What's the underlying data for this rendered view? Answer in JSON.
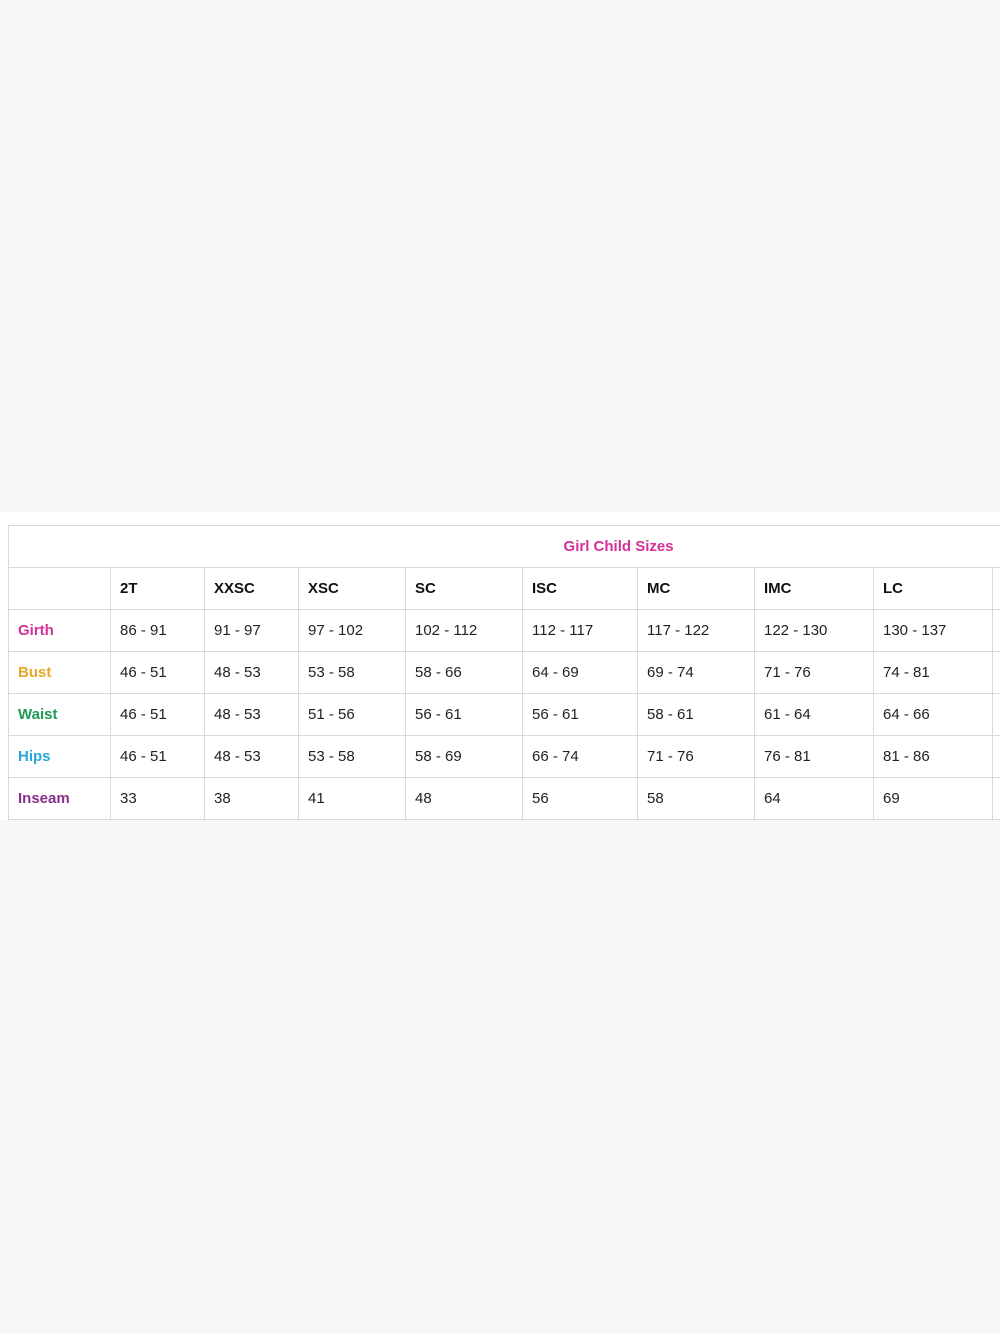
{
  "table": {
    "title": "Girl Child Sizes",
    "sizes": [
      "2T",
      "XXSC",
      "XSC",
      "SC",
      "ISC",
      "MC",
      "IMC",
      "LC"
    ],
    "rows": [
      {
        "label": "Girth",
        "color": "#d62f9a",
        "values": [
          "86 - 91",
          "91 - 97",
          "97 - 102",
          "102 - 112",
          "112 - 117",
          "117 - 122",
          "122 - 130",
          "130 - 137"
        ]
      },
      {
        "label": "Bust",
        "color": "#e6a82b",
        "values": [
          "46 - 51",
          "48 - 53",
          "53 - 58",
          "58 - 66",
          "64 - 69",
          "69 - 74",
          "71 - 76",
          "74 - 81"
        ]
      },
      {
        "label": "Waist",
        "color": "#1f9a55",
        "values": [
          "46 - 51",
          "48 - 53",
          "51 - 56",
          "56 - 61",
          "56 - 61",
          "58 - 61",
          "61 - 64",
          "64 - 66"
        ]
      },
      {
        "label": "Hips",
        "color": "#27a7d8",
        "values": [
          "46 - 51",
          "48 - 53",
          "53 - 58",
          "58 - 69",
          "66 - 74",
          "71 - 76",
          "76 - 81",
          "81 - 86"
        ]
      },
      {
        "label": "Inseam",
        "color": "#8b2f8f",
        "values": [
          "33",
          "38",
          "41",
          "48",
          "56",
          "58",
          "64",
          "69"
        ]
      }
    ]
  }
}
